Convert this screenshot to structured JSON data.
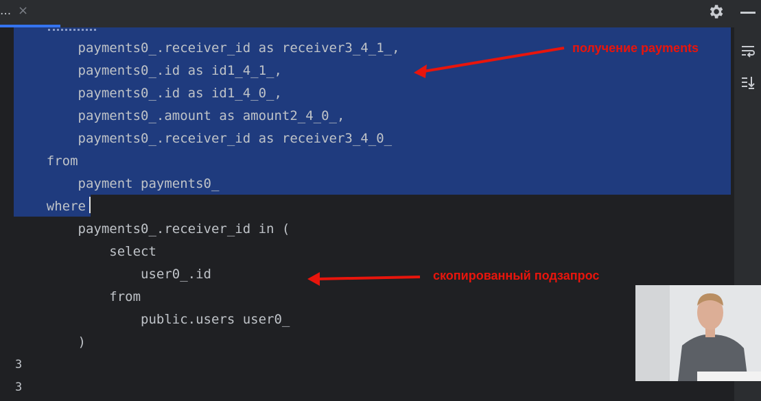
{
  "tab": {
    "title": "...",
    "close_glyph": "×"
  },
  "toolbar": {
    "settings_icon": "gear-icon",
    "minimize_icon": "minimize-icon"
  },
  "right_toolbar": {
    "icons": [
      "soft-wrap-icon",
      "scroll-to-end-icon"
    ]
  },
  "code": {
    "lines": [
      "        payments0_.receiver_id as receiver3_4_1_,",
      "        payments0_.id as id1_4_1_,",
      "        payments0_.id as id1_4_0_,",
      "        payments0_.amount as amount2_4_0_,",
      "        payments0_.receiver_id as receiver3_4_0_",
      "    from",
      "        payment payments0_",
      "    where",
      "        payments0_.receiver_id in (",
      "            select",
      "                user0_.id",
      "            from",
      "                public.users user0_",
      "        )"
    ],
    "output_lines": [
      "3",
      "3"
    ]
  },
  "annotations": {
    "payments": "получение payments",
    "subquery": "скопированный подзапрос"
  },
  "colors": {
    "selection": "#1f3b7e",
    "editor_bg": "#1f2023",
    "annotation_red": "#e8150c",
    "accent_blue": "#3574f0"
  }
}
